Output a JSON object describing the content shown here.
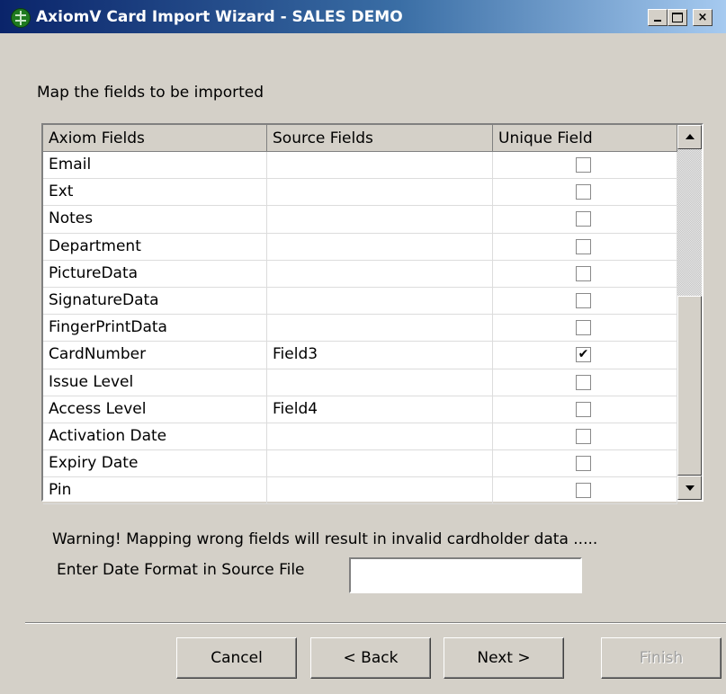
{
  "window": {
    "title": "AxiomV  Card Import Wizard - SALES DEMO",
    "icon": "axiom-globe-icon",
    "controls": {
      "minimize": "minimize-icon",
      "maximize": "maximize-icon",
      "close": "×"
    }
  },
  "instruction": "Map the fields to be imported",
  "grid": {
    "columns": [
      "Axiom Fields",
      "Source Fields",
      "Unique Field"
    ],
    "rows": [
      {
        "axiom": "Email",
        "source": "",
        "unique": false
      },
      {
        "axiom": "Ext",
        "source": "",
        "unique": false
      },
      {
        "axiom": "Notes",
        "source": "",
        "unique": false
      },
      {
        "axiom": "Department",
        "source": "",
        "unique": false
      },
      {
        "axiom": "PictureData",
        "source": "",
        "unique": false
      },
      {
        "axiom": "SignatureData",
        "source": "",
        "unique": false
      },
      {
        "axiom": "FingerPrintData",
        "source": "",
        "unique": false
      },
      {
        "axiom": "CardNumber",
        "source": "Field3",
        "unique": true
      },
      {
        "axiom": "Issue Level",
        "source": "",
        "unique": false
      },
      {
        "axiom": "Access Level",
        "source": "Field4",
        "unique": false
      },
      {
        "axiom": "Activation Date",
        "source": "",
        "unique": false
      },
      {
        "axiom": "Expiry Date",
        "source": "",
        "unique": false
      },
      {
        "axiom": "Pin",
        "source": "",
        "unique": false
      }
    ]
  },
  "warning": "Warning!  Mapping wrong fields will result in invalid cardholder data .....",
  "date_format": {
    "label": "Enter Date Format in Source File",
    "value": ""
  },
  "buttons": {
    "cancel": "Cancel",
    "back": "< Back",
    "next": "Next >",
    "finish": "Finish"
  }
}
